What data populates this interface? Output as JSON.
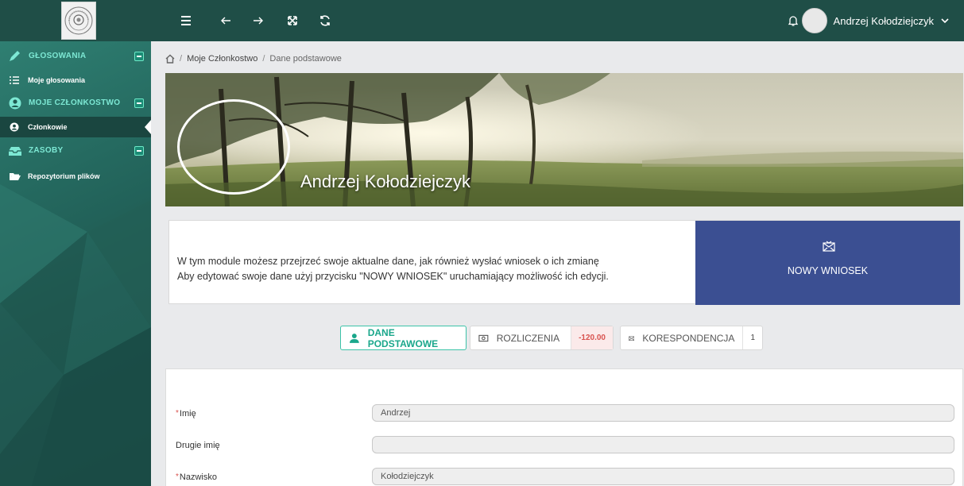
{
  "topbar": {
    "user_name": "Andrzej Kołodziejczyk"
  },
  "sidebar": {
    "groups": [
      {
        "label": "GŁOSOWANIA",
        "items": [
          {
            "label": "Moje głosowania"
          }
        ]
      },
      {
        "label": "MOJE CZŁONKOSTWO",
        "items": [
          {
            "label": "Członkowie"
          }
        ]
      },
      {
        "label": "ZASOBY",
        "items": [
          {
            "label": "Repozytorium plików"
          }
        ]
      }
    ]
  },
  "breadcrumb": {
    "items": [
      "Moje Członkostwo",
      "Dane podstawowe"
    ]
  },
  "banner": {
    "name": "Andrzej Kołodziejczyk"
  },
  "info": {
    "line1": "W tym module możesz przejrzeć swoje aktualne dane, jak również wysłać wniosek o ich zmianę",
    "line2": "Aby edytować swoje dane użyj przycisku \"NOWY WNIOSEK\" uruchamiający możliwość ich edycji.",
    "new_request_label": "NOWY WNIOSEK"
  },
  "tabs": [
    {
      "label": "DANE PODSTAWOWE",
      "badge": null,
      "active": true
    },
    {
      "label": "ROZLICZENIA",
      "badge": "-120.00",
      "active": false
    },
    {
      "label": "KORESPONDENCJA",
      "badge": "1",
      "active": false
    }
  ],
  "form": {
    "fields": [
      {
        "label": "Imię",
        "required": true,
        "value": "Andrzej"
      },
      {
        "label": "Drugie imię",
        "required": false,
        "value": ""
      },
      {
        "label": "Nazwisko",
        "required": true,
        "value": "Kołodziejczyk"
      }
    ]
  },
  "colors": {
    "topbar": "#1f4e47",
    "sidebar_accent": "#7de8d4",
    "primary_button": "#3b4f92",
    "active_tab": "#1aa78b",
    "negative_badge": "#d9534f"
  }
}
